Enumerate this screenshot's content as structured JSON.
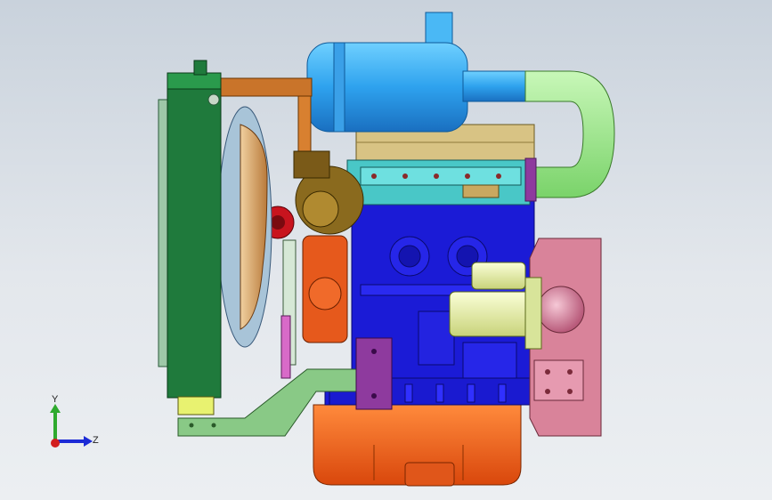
{
  "viewport": {
    "background_top": "#c9d2dc",
    "background_bottom": "#eceff2"
  },
  "triad": {
    "y_label": "Y",
    "z_label": "Z",
    "y_color": "#2eaa2e",
    "z_color": "#1c2bd6",
    "x_color": "#d21e1e"
  },
  "parts": {
    "radiator": "#1f7a3c",
    "fan": "#d9a46a",
    "fan_shroud": "#9fb7c8",
    "air_filter": "#2ea2ee",
    "intake_elbow": "#8ce07a",
    "breather_pipe": "#c9742a",
    "valve_cover": "#d8c384",
    "cylinder_head": "#49c7c7",
    "engine_block": "#1b1bd6",
    "oil_pan": "#ee5a16",
    "starter_motor": "#e7f3a2",
    "flywheel_housing": "#d9839a",
    "front_bracket": "#89c986",
    "alternator": "#8a6a1e",
    "water_pump": "#e6591c",
    "pulley": "#c8141e",
    "mount_plate": "#8e3a9e"
  }
}
